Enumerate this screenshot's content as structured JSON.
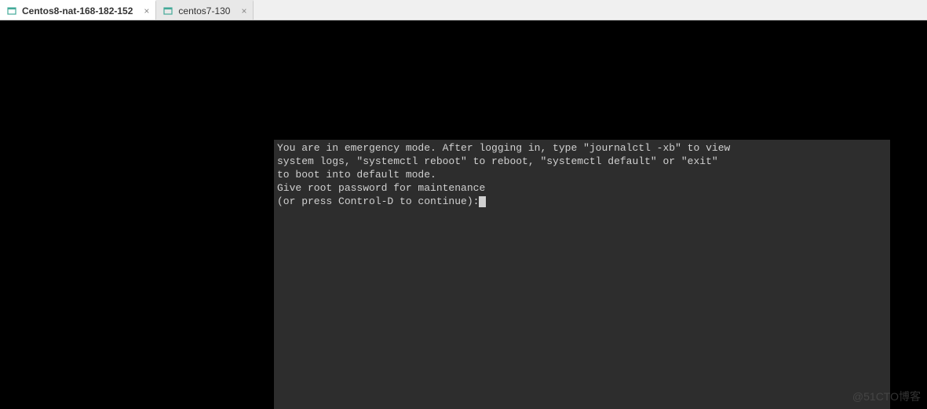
{
  "tabs": [
    {
      "label": "Centos8-nat-168-182-152",
      "active": true
    },
    {
      "label": "centos7-130",
      "active": false
    }
  ],
  "console": {
    "line1": "You are in emergency mode. After logging in, type \"journalctl -xb\" to view",
    "line2": "system logs, \"systemctl reboot\" to reboot, \"systemctl default\" or \"exit\"",
    "line3": "to boot into default mode.",
    "line4": "Give root password for maintenance",
    "line5": "(or press Control-D to continue):"
  },
  "watermark": "@51CTO博客"
}
